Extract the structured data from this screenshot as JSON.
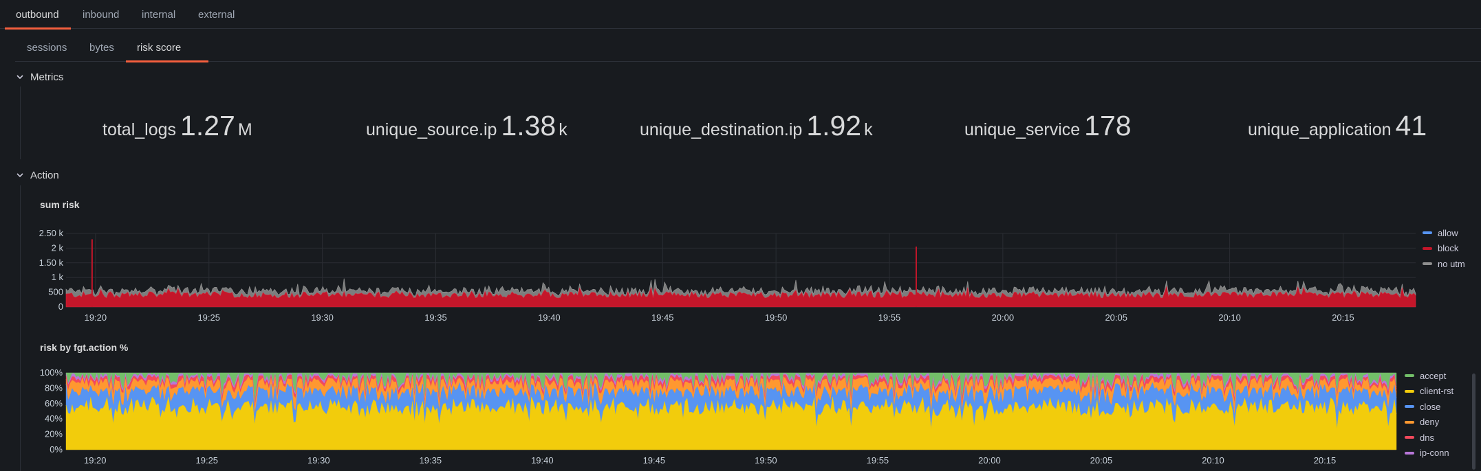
{
  "tabs_primary": [
    {
      "label": "outbound",
      "active": true
    },
    {
      "label": "inbound",
      "active": false
    },
    {
      "label": "internal",
      "active": false
    },
    {
      "label": "external",
      "active": false
    }
  ],
  "tabs_secondary": [
    {
      "label": "sessions",
      "active": false
    },
    {
      "label": "bytes",
      "active": false
    },
    {
      "label": "risk score",
      "active": true
    }
  ],
  "rows": {
    "metrics": {
      "title": "Metrics"
    },
    "action": {
      "title": "Action"
    }
  },
  "stats": [
    {
      "label": "total_logs",
      "value": "1.27",
      "unit": "M"
    },
    {
      "label": "unique_source.ip",
      "value": "1.38",
      "unit": "k"
    },
    {
      "label": "unique_destination.ip",
      "value": "1.92",
      "unit": "k"
    },
    {
      "label": "unique_service",
      "value": "178",
      "unit": ""
    },
    {
      "label": "unique_application",
      "value": "41",
      "unit": ""
    }
  ],
  "colors": {
    "allow": "#5794f2",
    "block": "#c4162a",
    "no_utm": "#8e8e8e",
    "accept": "#73bf69",
    "client_rst": "#f2cc0c",
    "close": "#5794f2",
    "deny": "#ff9830",
    "dns": "#f2495c",
    "ip_conn": "#b877d9",
    "tab_accent": "#f55f3e"
  },
  "chart_data": [
    {
      "type": "area",
      "title": "sum risk",
      "stacked": true,
      "x_ticks": [
        "19:20",
        "19:25",
        "19:30",
        "19:35",
        "19:40",
        "19:45",
        "19:50",
        "19:55",
        "20:00",
        "20:05",
        "20:10",
        "20:15"
      ],
      "y_ticks": [
        "0",
        "500",
        "1 k",
        "1.50 k",
        "2 k",
        "2.50 k"
      ],
      "ylim": [
        0,
        2500
      ],
      "legend": [
        "allow",
        "block",
        "no utm"
      ],
      "legend_position": "right",
      "grid": true,
      "series": [
        {
          "name": "allow",
          "typical": 2
        },
        {
          "name": "block",
          "typical": 450,
          "range": [
            250,
            700
          ]
        },
        {
          "name": "no utm",
          "typical": 150,
          "range": [
            50,
            450
          ]
        }
      ],
      "spikes": [
        {
          "x": "19:20",
          "value": 2300
        },
        {
          "x": "19:56",
          "value": 2050
        }
      ]
    },
    {
      "type": "area",
      "title": "risk by fgt.action %",
      "stacked": true,
      "percent": true,
      "x_ticks": [
        "19:20",
        "19:25",
        "19:30",
        "19:35",
        "19:40",
        "19:45",
        "19:50",
        "19:55",
        "20:00",
        "20:05",
        "20:10",
        "20:15"
      ],
      "y_ticks": [
        "0%",
        "20%",
        "40%",
        "60%",
        "80%",
        "100%"
      ],
      "ylim": [
        0,
        100
      ],
      "legend": [
        "accept",
        "client-rst",
        "close",
        "deny",
        "dns",
        "ip-conn"
      ],
      "legend_position": "right",
      "grid": true,
      "series": [
        {
          "name": "client-rst",
          "typical": 55
        },
        {
          "name": "close",
          "typical": 22
        },
        {
          "name": "deny",
          "typical": 12
        },
        {
          "name": "dns",
          "typical": 5
        },
        {
          "name": "ip-conn",
          "typical": 4
        },
        {
          "name": "accept",
          "typical": 2
        }
      ]
    }
  ]
}
